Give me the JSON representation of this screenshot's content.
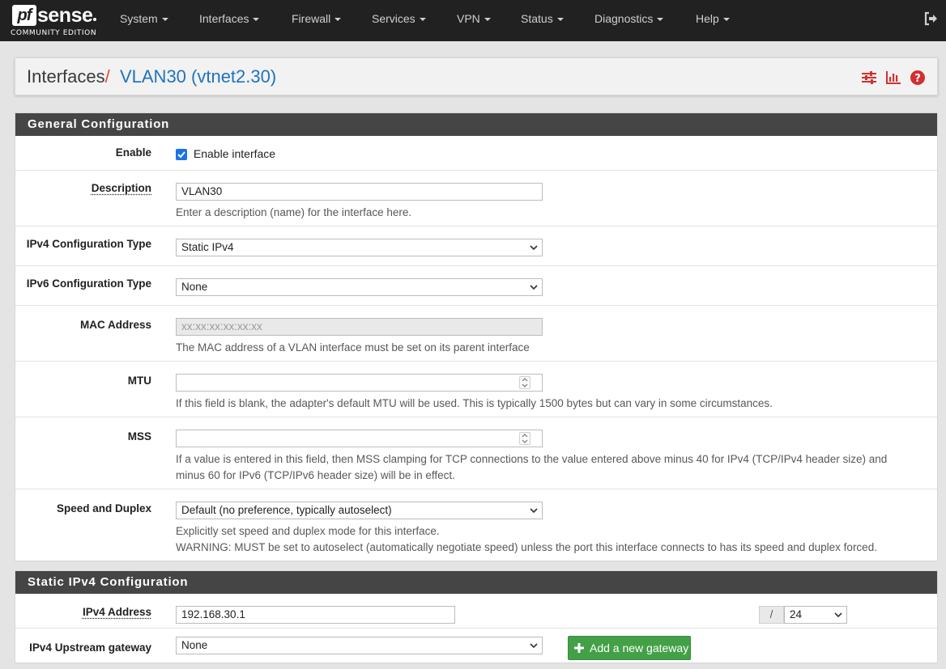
{
  "brand": {
    "logo_mark": "pf",
    "logo_word": "sense",
    "edition": "COMMUNITY EDITION"
  },
  "nav": {
    "system": "System",
    "interfaces": "Interfaces",
    "firewall": "Firewall",
    "services": "Services",
    "vpn": "VPN",
    "status": "Status",
    "diagnostics": "Diagnostics",
    "help": "Help"
  },
  "breadcrumb": {
    "root": "Interfaces",
    "separator": "/",
    "current": "VLAN30 (vtnet2.30)"
  },
  "icons": {
    "logout": "sign-out-icon",
    "settings": "sliders-icon",
    "chart": "bar-chart-icon",
    "help": "question-circle-icon"
  },
  "colors": {
    "accent": "#1e73be",
    "separator": "#e04a3a",
    "success": "#43a047",
    "heading": "#454545",
    "help_icon": "#d32f2f"
  },
  "general": {
    "heading": "General Configuration",
    "enable": {
      "label": "Enable",
      "checkbox_label": "Enable interface",
      "checked": true
    },
    "description": {
      "label": "Description",
      "value": "VLAN30",
      "help": "Enter a description (name) for the interface here."
    },
    "ipv4_type": {
      "label": "IPv4 Configuration Type",
      "value": "Static IPv4"
    },
    "ipv6_type": {
      "label": "IPv6 Configuration Type",
      "value": "None"
    },
    "mac": {
      "label": "MAC Address",
      "placeholder": "xx:xx:xx:xx:xx:xx",
      "help": "The MAC address of a VLAN interface must be set on its parent interface"
    },
    "mtu": {
      "label": "MTU",
      "value": "",
      "help": "If this field is blank, the adapter's default MTU will be used. This is typically 1500 bytes but can vary in some circumstances."
    },
    "mss": {
      "label": "MSS",
      "value": "",
      "help1": "If a value is entered in this field, then MSS clamping for TCP connections to the value entered above minus 40 for IPv4 (TCP/IPv4 header size) and",
      "help2": "minus 60 for IPv6 (TCP/IPv6 header size) will be in effect."
    },
    "speed": {
      "label": "Speed and Duplex",
      "value": "Default (no preference, typically autoselect)",
      "help1": "Explicitly set speed and duplex mode for this interface.",
      "help2": "WARNING: MUST be set to autoselect (automatically negotiate speed) unless the port this interface connects to has its speed and duplex forced."
    }
  },
  "static_ipv4": {
    "heading": "Static IPv4 Configuration",
    "address": {
      "label": "IPv4 Address",
      "value": "192.168.30.1",
      "slash": "/",
      "prefix": "24"
    },
    "gateway": {
      "label": "IPv4 Upstream gateway",
      "value": "None",
      "add_button": "Add a new gateway"
    }
  }
}
